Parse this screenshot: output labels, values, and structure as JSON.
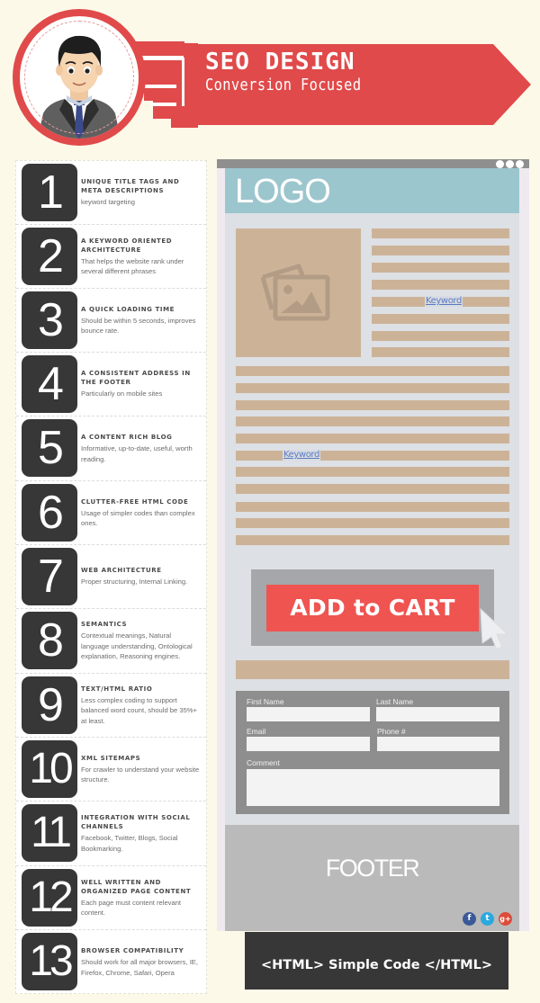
{
  "header": {
    "title": "SEO DESIGN",
    "subtitle": "Conversion Focused",
    "brand_color": "#e04a4a"
  },
  "list": {
    "items": [
      {
        "number": "1",
        "title": "UNIQUE TITLE TAGS AND META DESCRIPTIONS",
        "description": "keyword targeting"
      },
      {
        "number": "2",
        "title": "A KEYWORD ORIENTED ARCHITECTURE",
        "description": "That helps the website rank under several different phrases"
      },
      {
        "number": "3",
        "title": "A QUICK LOADING TIME",
        "description": "Should be within 5 seconds, improves bounce rate."
      },
      {
        "number": "4",
        "title": "A CONSISTENT ADDRESS IN THE FOOTER",
        "description": "Particularly on mobile sites"
      },
      {
        "number": "5",
        "title": "A CONTENT RICH BLOG",
        "description": "Informative, up-to-date, useful, worth reading."
      },
      {
        "number": "6",
        "title": "CLUTTER-FREE HTML CODE",
        "description": "Usage of simpler codes than complex ones."
      },
      {
        "number": "7",
        "title": "WEB ARCHITECTURE",
        "description": "Proper structuring, Internal Linking."
      },
      {
        "number": "8",
        "title": "SEMANTICS",
        "description": "Contextual meanings, Natural language understanding, Ontological explanation, Reasoning engines."
      },
      {
        "number": "9",
        "title": "TEXT/HTML RATIO",
        "description": "Less complex coding to support balanced word count, should be 35%+ at least."
      },
      {
        "number": "10",
        "title": "XML SITEMAPS",
        "description": "For crawler to understand your website structure."
      },
      {
        "number": "11",
        "title": "INTEGRATION WITH SOCIAL CHANNELS",
        "description": "Facebook, Twitter, Blogs, Social Bookmarking."
      },
      {
        "number": "12",
        "title": "WELL WRITTEN AND ORGANIZED PAGE CONTENT",
        "description": "Each page must content relevant content."
      },
      {
        "number": "13",
        "title": "BROWSER COMPATIBILITY",
        "description": "Should work for all major browsers, IE, Firefox, Chrome, Safari, Opera"
      }
    ]
  },
  "mockup": {
    "logo": "LOGO",
    "keyword_1": "Keyword",
    "keyword_2": "Keyword",
    "cta_label": "ADD to CART",
    "form": {
      "first_name_label": "First Name",
      "last_name_label": "Last Name",
      "email_label": "Email",
      "phone_label": "Phone #",
      "comment_label": "Comment",
      "first_name_value": "",
      "last_name_value": "",
      "email_value": "",
      "phone_value": "",
      "comment_value": ""
    },
    "footer_label": "FOOTER",
    "social": [
      {
        "name": "facebook-icon",
        "glyph": "f",
        "color": "#3b5998"
      },
      {
        "name": "twitter-icon",
        "glyph": "t",
        "color": "#2aa9e0"
      },
      {
        "name": "google-plus-icon",
        "glyph": "g+",
        "color": "#dd4b39"
      }
    ],
    "colors": {
      "accent_red": "#ef5451",
      "logo_bar": "#9cc6cd",
      "placeholder_tan": "#ccb398"
    }
  },
  "code_banner": "<HTML> Simple Code </HTML>"
}
